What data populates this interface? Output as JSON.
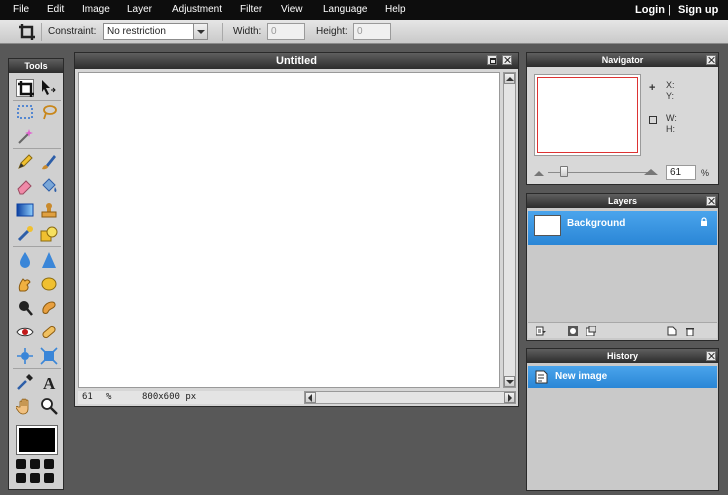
{
  "menubar": {
    "items": [
      "File",
      "Edit",
      "Image",
      "Layer",
      "Adjustment",
      "Filter",
      "View",
      "Language",
      "Help"
    ],
    "login": "Login",
    "separator": "|",
    "signup": "Sign up"
  },
  "options": {
    "active_tool_icon": "crop-icon",
    "constraint_label": "Constraint:",
    "constraint_value": "No restriction",
    "width_label": "Width:",
    "width_value": "0",
    "height_label": "Height:",
    "height_value": "0"
  },
  "tools": {
    "title": "Tools",
    "icons": [
      "crop-icon",
      "move-icon",
      "marquee-icon",
      "lasso-icon",
      "wand-icon",
      "pencil-icon",
      "brush-icon",
      "eraser-icon",
      "bucket-icon",
      "gradient-icon",
      "stamp-icon",
      "color-replace-icon",
      "shape-icon",
      "blur-icon",
      "sharpen-icon",
      "smudge-icon",
      "sponge-icon",
      "dodge-icon",
      "burn-icon",
      "redeye-icon",
      "spot-heal-icon",
      "bloat-icon",
      "pinch-icon",
      "eyedropper-icon",
      "type-icon",
      "hand-icon",
      "zoom-icon"
    ],
    "foreground_color": "#000000"
  },
  "document": {
    "title": "Untitled",
    "zoom": "61",
    "zoom_unit": "%",
    "size": "800x600 px"
  },
  "navigator": {
    "title": "Navigator",
    "x_label": "X:",
    "y_label": "Y:",
    "w_label": "W:",
    "h_label": "H:",
    "zoom_value": "61",
    "zoom_unit": "%"
  },
  "layers": {
    "title": "Layers",
    "items": [
      {
        "name": "Background"
      }
    ]
  },
  "history": {
    "title": "History",
    "items": [
      {
        "name": "New image"
      }
    ]
  },
  "colors": {
    "selection_blue": "#3598e6",
    "menubar": "#0d0d0d",
    "workspace": "#585858"
  }
}
